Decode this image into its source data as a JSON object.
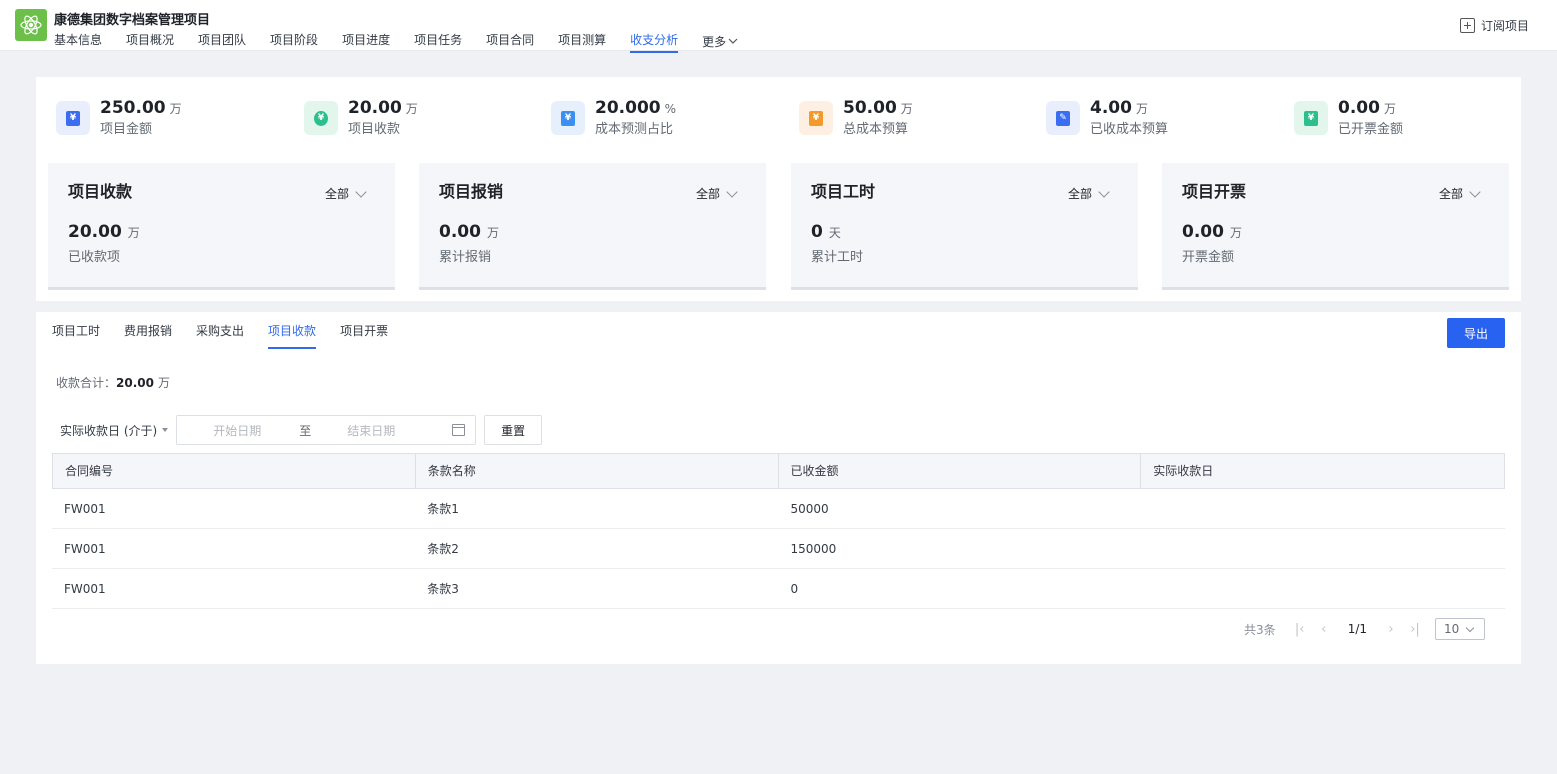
{
  "header": {
    "title": "康德集团数字档案管理项目",
    "nav": [
      {
        "label": "基本信息",
        "active": false
      },
      {
        "label": "项目概况",
        "active": false
      },
      {
        "label": "项目团队",
        "active": false
      },
      {
        "label": "项目阶段",
        "active": false
      },
      {
        "label": "项目进度",
        "active": false
      },
      {
        "label": "项目任务",
        "active": false
      },
      {
        "label": "项目合同",
        "active": false
      },
      {
        "label": "项目测算",
        "active": false
      },
      {
        "label": "收支分析",
        "active": true
      }
    ],
    "more_label": "更多",
    "subscribe_label": "订阅项目"
  },
  "stats": [
    {
      "value": "250.00",
      "unit": "万",
      "label": "项目金额",
      "icon": "project-amount-icon",
      "color": "#3b6df2",
      "bg": "#e8eefc"
    },
    {
      "value": "20.00",
      "unit": "万",
      "label": "项目收款",
      "icon": "receipt-icon",
      "color": "#2bbf8e",
      "bg": "#e3f6ee"
    },
    {
      "value": "20.000",
      "unit": "%",
      "label": "成本预测占比",
      "icon": "cost-ratio-icon",
      "color": "#3b8ff2",
      "bg": "#e6f0fc"
    },
    {
      "value": "50.00",
      "unit": "万",
      "label": "总成本预算",
      "icon": "budget-icon",
      "color": "#f39a2b",
      "bg": "#fdf0e2"
    },
    {
      "value": "4.00",
      "unit": "万",
      "label": "已收成本预算",
      "icon": "received-budget-icon",
      "color": "#3b6df2",
      "bg": "#e8eefc"
    },
    {
      "value": "0.00",
      "unit": "万",
      "label": "已开票金额",
      "icon": "invoice-icon",
      "color": "#2bbf8e",
      "bg": "#e3f6ee"
    }
  ],
  "cards": [
    {
      "title": "项目收款",
      "filter": "全部",
      "value": "20.00",
      "unit": "万",
      "label": "已收款项"
    },
    {
      "title": "项目报销",
      "filter": "全部",
      "value": "0.00",
      "unit": "万",
      "label": "累计报销"
    },
    {
      "title": "项目工时",
      "filter": "全部",
      "value": "0",
      "unit": "天",
      "label": "累计工时"
    },
    {
      "title": "项目开票",
      "filter": "全部",
      "value": "0.00",
      "unit": "万",
      "label": "开票金额"
    }
  ],
  "tabs": [
    {
      "label": "项目工时",
      "active": false
    },
    {
      "label": "费用报销",
      "active": false
    },
    {
      "label": "采购支出",
      "active": false
    },
    {
      "label": "项目收款",
      "active": true
    },
    {
      "label": "项目开票",
      "active": false
    }
  ],
  "export_label": "导出",
  "summary": {
    "label": "收款合计：",
    "value": "20.00",
    "unit": "万"
  },
  "filter": {
    "field_label": "实际收款日 (介于)",
    "start_placeholder": "开始日期",
    "to_label": "至",
    "end_placeholder": "结束日期",
    "reset_label": "重置"
  },
  "table": {
    "columns": [
      "合同编号",
      "条款名称",
      "已收金额",
      "实际收款日"
    ],
    "rows": [
      [
        "FW001",
        "条款1",
        "50000",
        ""
      ],
      [
        "FW001",
        "条款2",
        "150000",
        ""
      ],
      [
        "FW001",
        "条款3",
        "0",
        ""
      ]
    ]
  },
  "pagination": {
    "total": "共3条",
    "current": "1/1",
    "page_size": "10"
  }
}
